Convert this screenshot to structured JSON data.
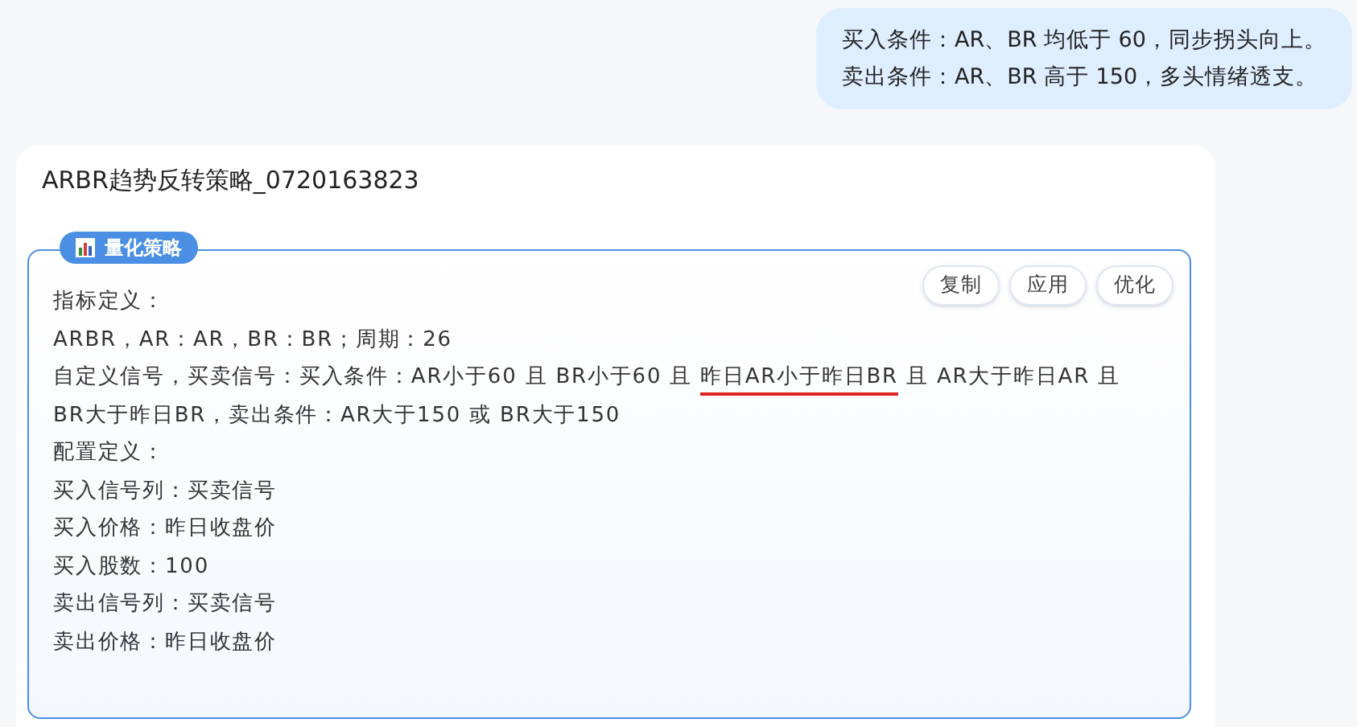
{
  "user_message": {
    "lines": [
      "买入条件：AR、BR 均低于 60，同步拐头向上。",
      "卖出条件：AR、BR 高于 150，多头情绪透支。"
    ]
  },
  "reply": {
    "title": "ARBR趋势反转策略_0720163823",
    "strategy": {
      "label": "量化策略",
      "buttons": [
        "复制",
        "应用",
        "优化"
      ],
      "lines": [
        [
          {
            "text": "指标定义：",
            "marked": false
          }
        ],
        [
          {
            "text": "ARBR，AR：AR，BR：BR；周期：26",
            "marked": false
          }
        ],
        [
          {
            "text": "自定义信号，买卖信号：买入条件：AR小于60 且 BR小于60 且 ",
            "marked": false
          },
          {
            "text": "昨日AR小于昨日BR",
            "marked": true
          },
          {
            "text": " 且 AR大于昨日AR 且",
            "marked": false
          }
        ],
        [
          {
            "text": "BR大于昨日BR，卖出条件：AR大于150 或 BR大于150",
            "marked": false
          }
        ],
        [
          {
            "text": "配置定义：",
            "marked": false
          }
        ],
        [
          {
            "text": "买入信号列：买卖信号",
            "marked": false
          }
        ],
        [
          {
            "text": "买入价格：昨日收盘价",
            "marked": false
          }
        ],
        [
          {
            "text": "买入股数：100",
            "marked": false
          }
        ],
        [
          {
            "text": "卖出信号列：买卖信号",
            "marked": false
          }
        ],
        [
          {
            "text": "卖出价格：昨日收盘价",
            "marked": false
          }
        ]
      ]
    }
  }
}
